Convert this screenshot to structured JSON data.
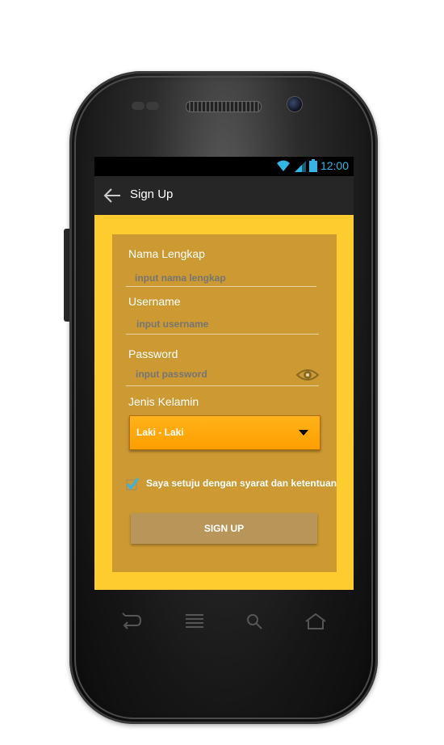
{
  "status_bar": {
    "time": "12:00"
  },
  "app_bar": {
    "title": "Sign Up"
  },
  "form": {
    "full_name": {
      "label": "Nama Lengkap",
      "placeholder": "input nama lengkap"
    },
    "username": {
      "label": "Username",
      "placeholder": "input username"
    },
    "password": {
      "label": "Password",
      "placeholder": "input password"
    },
    "gender": {
      "label": "Jenis Kelamin",
      "selected": "Laki - Laki"
    },
    "agreement": {
      "label": "Saya setuju dengan syarat dan ketentuan",
      "checked": true
    },
    "submit_label": "SIGN UP"
  },
  "colors": {
    "screen_background": "#ffcc2f",
    "card_background": "#cc9932",
    "app_bar": "#262626",
    "select_accent": "#ff9f00",
    "checkbox_accent": "#33b5e5",
    "button": "#b8965a"
  },
  "icons": [
    "wifi-icon",
    "signal-icon",
    "battery-icon",
    "back-arrow-icon",
    "eye-icon",
    "chevron-down-icon",
    "checkbox-checked-icon",
    "back-key-icon",
    "menu-key-icon",
    "search-key-icon",
    "home-key-icon"
  ]
}
